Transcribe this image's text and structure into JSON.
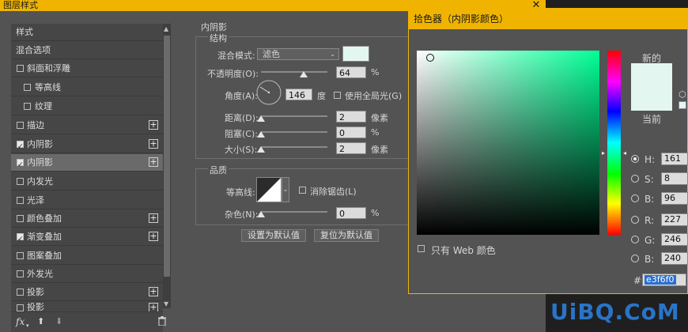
{
  "layer_style": {
    "title": "图层样式",
    "close_glyph": "✕",
    "styles_header": "样式",
    "items": [
      {
        "label": "混合选项",
        "checkbox": null,
        "plus": false,
        "selected": false,
        "indent": false
      },
      {
        "label": "斜面和浮雕",
        "checkbox": false,
        "plus": false,
        "selected": false,
        "indent": false
      },
      {
        "label": "等高线",
        "checkbox": false,
        "plus": false,
        "selected": false,
        "indent": true
      },
      {
        "label": "纹理",
        "checkbox": false,
        "plus": false,
        "selected": false,
        "indent": true
      },
      {
        "label": "描边",
        "checkbox": false,
        "plus": true,
        "selected": false,
        "indent": false
      },
      {
        "label": "内阴影",
        "checkbox": true,
        "plus": true,
        "selected": false,
        "indent": false
      },
      {
        "label": "内阴影",
        "checkbox": true,
        "plus": true,
        "selected": true,
        "indent": false
      },
      {
        "label": "内发光",
        "checkbox": false,
        "plus": false,
        "selected": false,
        "indent": false
      },
      {
        "label": "光泽",
        "checkbox": false,
        "plus": false,
        "selected": false,
        "indent": false
      },
      {
        "label": "颜色叠加",
        "checkbox": false,
        "plus": true,
        "selected": false,
        "indent": false
      },
      {
        "label": "渐变叠加",
        "checkbox": true,
        "plus": true,
        "selected": false,
        "indent": false
      },
      {
        "label": "图案叠加",
        "checkbox": false,
        "plus": false,
        "selected": false,
        "indent": false
      },
      {
        "label": "外发光",
        "checkbox": false,
        "plus": false,
        "selected": false,
        "indent": false
      },
      {
        "label": "投影",
        "checkbox": false,
        "plus": true,
        "selected": false,
        "indent": false
      },
      {
        "label": "投影",
        "checkbox": false,
        "plus": true,
        "selected": false,
        "indent": false
      }
    ],
    "fx_label": "fx",
    "inner_shadow": {
      "section_title": "内阴影",
      "structure_title": "结构",
      "blend_mode_label": "混合模式:",
      "blend_mode_value": "滤色",
      "shadow_color": "#e3f6f0",
      "opacity_label": "不透明度(O):",
      "opacity_value": "64",
      "opacity_level": 0.64,
      "percent": "%",
      "angle_label": "角度(A):",
      "angle_value": "146",
      "degree_label": "度",
      "global_light_label": "使用全局光(G)",
      "distance_label": "距离(D):",
      "distance_value": "2",
      "choke_label": "阻塞(C):",
      "choke_value": "0",
      "size_label": "大小(S):",
      "size_value": "2",
      "px_label": "像素",
      "quality_title": "品质",
      "contour_label": "等高线:",
      "anti_alias_label": "消除锯齿(L)",
      "noise_label": "杂色(N):",
      "noise_value": "0",
      "set_default_button": "设置为默认值",
      "reset_default_button": "复位为默认值"
    }
  },
  "color_picker": {
    "title": "拾色器（内阴影颜色）",
    "new_label": "新的",
    "current_label": "当前",
    "new_color": "#e3f6f0",
    "current_color": "#e3f6f0",
    "web_only_label": "只有 Web 颜色",
    "fields": [
      {
        "label": "H:",
        "value": "161",
        "selected": true
      },
      {
        "label": "S:",
        "value": "8",
        "selected": false
      },
      {
        "label": "B:",
        "value": "96",
        "selected": false
      },
      {
        "label": "R:",
        "value": "227",
        "selected": false
      },
      {
        "label": "G:",
        "value": "246",
        "selected": false
      },
      {
        "label": "B:",
        "value": "240",
        "selected": false
      }
    ],
    "hash": "#",
    "hex_value": "e3f6f0"
  },
  "watermark": {
    "text": "UiBQ.CoM",
    "accent": "#2a74c7"
  }
}
